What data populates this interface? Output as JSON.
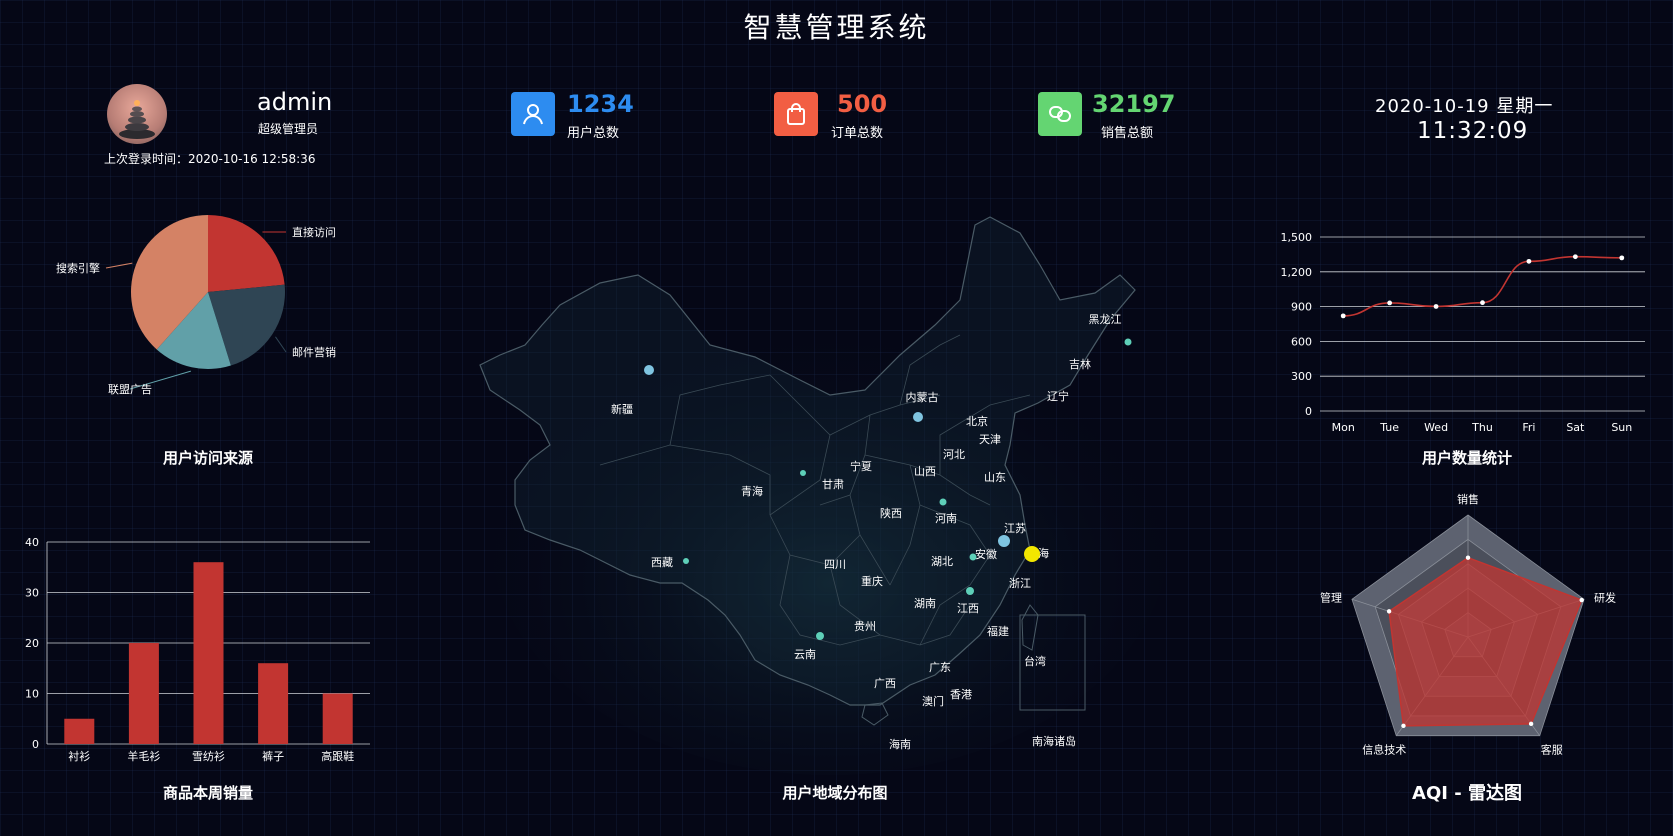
{
  "header": {
    "title": "智慧管理系统"
  },
  "user": {
    "name": "admin",
    "role": "超级管理员",
    "last_login": "上次登录时间：2020-10-16 12:58:36"
  },
  "stats": [
    {
      "value": "1234",
      "label": "用户总数",
      "color": "#2d8cf0",
      "icon": "user-icon"
    },
    {
      "value": "500",
      "label": "订单总数",
      "color": "#f25e43",
      "icon": "shopping-bag-icon"
    },
    {
      "value": "32197",
      "label": "销售总额",
      "color": "#64d572",
      "icon": "link-icon"
    }
  ],
  "clock": {
    "date": "2020-10-19  星期一",
    "time": "11:32:09"
  },
  "panels": {
    "pie_title": "用户访问来源",
    "bar_title": "商品本周销量",
    "map_title": "用户地域分布图",
    "line_title": "用户数量统计",
    "radar_title": "AQI - 雷达图"
  },
  "map": {
    "provinces": [
      "新疆",
      "西藏",
      "青海",
      "甘肃",
      "宁夏",
      "内蒙古",
      "黑龙江",
      "吉林",
      "辽宁",
      "北京",
      "天津",
      "河北",
      "山西",
      "陕西",
      "山东",
      "河南",
      "江苏",
      "安徽",
      "上海",
      "湖北",
      "四川",
      "重庆",
      "浙江",
      "湖南",
      "江西",
      "贵州",
      "云南",
      "福建",
      "广西",
      "广东",
      "台湾",
      "澳门",
      "香港",
      "海南",
      "南海诸岛"
    ]
  },
  "chart_data": [
    {
      "type": "pie",
      "categories": [
        "直接访问",
        "邮件营销",
        "联盟广告",
        "搜索引擎"
      ],
      "values": [
        335,
        310,
        234,
        548
      ],
      "colors": [
        "#c23531",
        "#2f4554",
        "#61a0a8",
        "#d48265"
      ]
    },
    {
      "type": "bar",
      "categories": [
        "衬衫",
        "羊毛衫",
        "雪纺衫",
        "裤子",
        "高跟鞋"
      ],
      "values": [
        5,
        20,
        36,
        16,
        10
      ],
      "ylim": [
        0,
        40
      ],
      "yticks": [
        "0",
        "10",
        "20",
        "30",
        "40"
      ],
      "color": "#c23531"
    },
    {
      "type": "line",
      "categories": [
        "Mon",
        "Tue",
        "Wed",
        "Thu",
        "Fri",
        "Sat",
        "Sun"
      ],
      "values": [
        820,
        932,
        901,
        934,
        1290,
        1330,
        1320
      ],
      "ylim": [
        0,
        1500
      ],
      "yticks": [
        "0",
        "300",
        "600",
        "900",
        "1,200",
        "1,500"
      ],
      "color": "#c23531"
    },
    {
      "type": "radar",
      "indicators": [
        "销售",
        "研发",
        "客服",
        "信息技术",
        "管理"
      ],
      "values": [
        0.65,
        0.98,
        0.88,
        0.9,
        0.68
      ],
      "color": "#c23531"
    }
  ]
}
